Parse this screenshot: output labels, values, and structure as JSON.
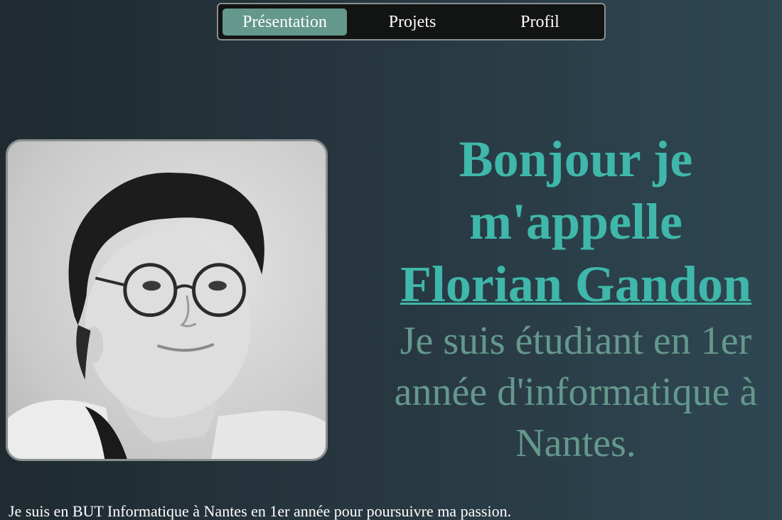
{
  "nav": {
    "items": [
      {
        "label": "Présentation",
        "active": true
      },
      {
        "label": "Projets",
        "active": false
      },
      {
        "label": "Profil",
        "active": false
      }
    ]
  },
  "hero": {
    "greeting_line1": "Bonjour je",
    "greeting_line2": "m'appelle",
    "name": "Florian Gandon",
    "subtitle_line1": "Je suis étudiant en 1er",
    "subtitle_line2": "année d'informatique à",
    "subtitle_line3": "Nantes."
  },
  "intro": {
    "text": "Je suis en BUT Informatique à Nantes en 1er année pour poursuivre ma passion."
  },
  "colors": {
    "accent": "#3fb7aa",
    "muted_accent": "#65988c",
    "nav_background": "#121414",
    "page_background": "#27363f"
  }
}
